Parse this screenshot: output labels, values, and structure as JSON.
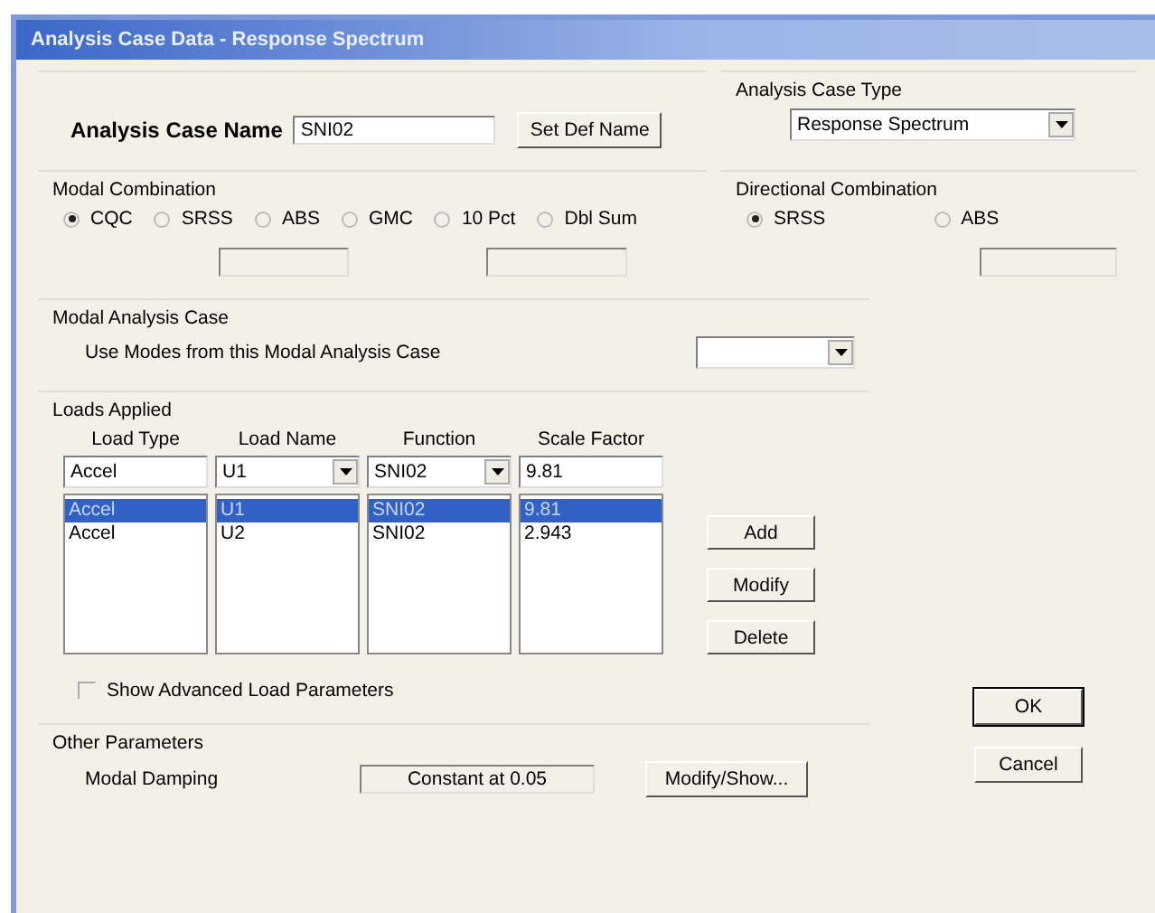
{
  "window": {
    "title": "Analysis Case Data - Response Spectrum"
  },
  "case_name": {
    "label": "Analysis Case Name",
    "value": "SNI02",
    "button": "Set Def Name"
  },
  "case_type": {
    "label": "Analysis Case Type",
    "value": "Response Spectrum"
  },
  "modal_combination": {
    "label": "Modal Combination",
    "options": [
      {
        "label": "CQC",
        "selected": true
      },
      {
        "label": "SRSS",
        "selected": false
      },
      {
        "label": "ABS",
        "selected": false
      },
      {
        "label": "GMC",
        "selected": false
      },
      {
        "label": "10 Pct",
        "selected": false
      },
      {
        "label": "Dbl Sum",
        "selected": false
      }
    ]
  },
  "directional_combination": {
    "label": "Directional Combination",
    "options": [
      {
        "label": "SRSS",
        "selected": true
      },
      {
        "label": "ABS",
        "selected": false
      }
    ]
  },
  "modal_analysis_case": {
    "label": "Modal Analysis Case",
    "prompt": "Use Modes from this Modal Analysis Case"
  },
  "loads_applied": {
    "label": "Loads Applied",
    "columns": [
      "Load Type",
      "Load Name",
      "Function",
      "Scale Factor"
    ],
    "entry": [
      {
        "kind": "field",
        "value": "Accel"
      },
      {
        "kind": "combo",
        "value": "U1"
      },
      {
        "kind": "combo",
        "value": "SNI02"
      },
      {
        "kind": "field",
        "value": "9.81"
      }
    ],
    "rows": [
      {
        "cells": [
          "Accel",
          "U1",
          "SNI02",
          "9.81"
        ],
        "selected": true
      },
      {
        "cells": [
          "Accel",
          "U2",
          "SNI02",
          "2.943"
        ],
        "selected": false
      }
    ],
    "buttons": [
      "Add",
      "Modify",
      "Delete"
    ]
  },
  "advanced": {
    "label": "Show Advanced Load Parameters",
    "checked": false
  },
  "other_parameters": {
    "label": "Other Parameters",
    "damping_label": "Modal Damping",
    "damping_value": "Constant at 0.05",
    "button": "Modify/Show..."
  },
  "buttons": [
    "OK",
    "Cancel"
  ]
}
